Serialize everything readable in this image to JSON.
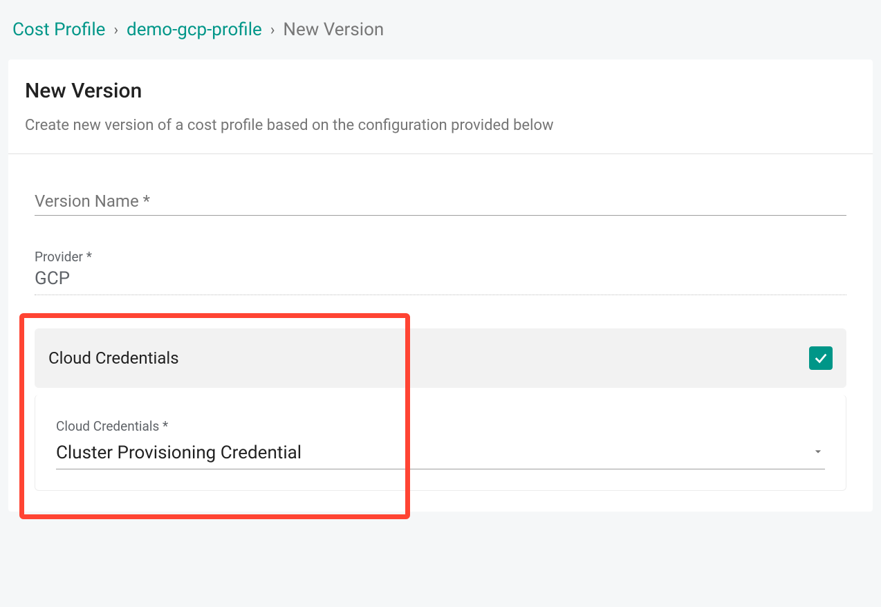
{
  "breadcrumb": {
    "root": "Cost Profile",
    "profile": "demo-gcp-profile",
    "current": "New Version"
  },
  "header": {
    "title": "New Version",
    "description": "Create new version of a cost profile based on the configuration provided below"
  },
  "form": {
    "versionName": {
      "label": "Version Name *",
      "value": ""
    },
    "provider": {
      "label": "Provider *",
      "value": "GCP"
    }
  },
  "cloudCredentials": {
    "title": "Cloud Credentials",
    "enabled": true,
    "label": "Cloud Credentials *",
    "selected": "Cluster Provisioning Credential"
  }
}
